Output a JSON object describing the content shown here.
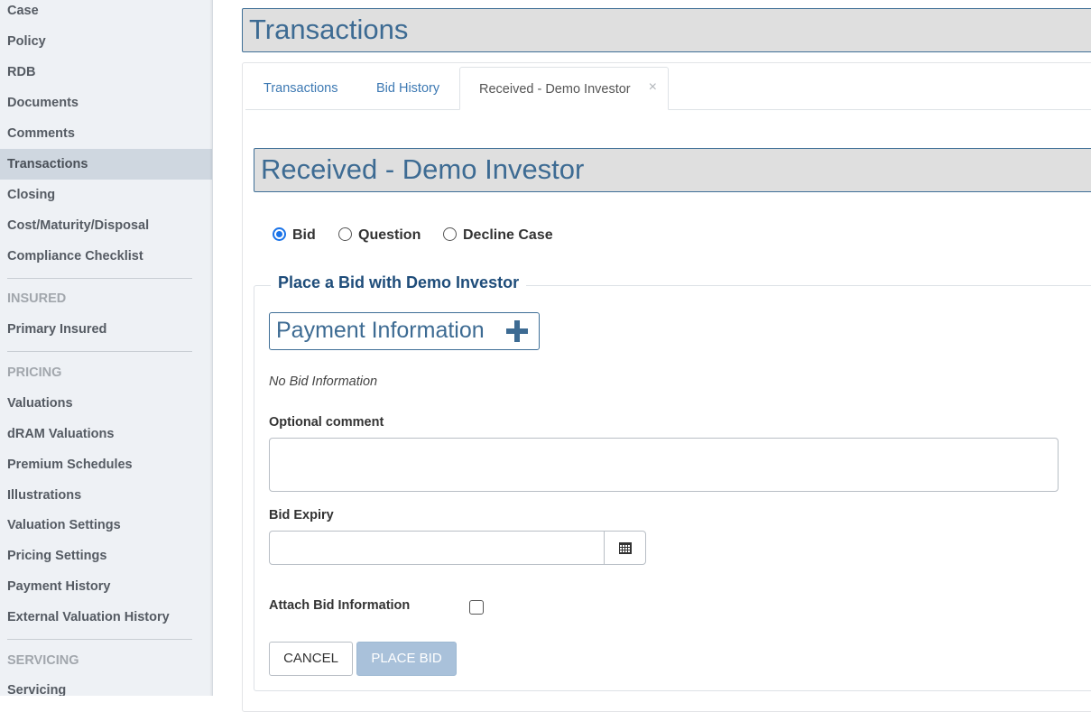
{
  "sidebar": {
    "items": [
      {
        "label": "Case"
      },
      {
        "label": "Policy"
      },
      {
        "label": "RDB"
      },
      {
        "label": "Documents"
      },
      {
        "label": "Comments"
      },
      {
        "label": "Transactions"
      },
      {
        "label": "Closing"
      },
      {
        "label": "Cost/Maturity/Disposal"
      },
      {
        "label": "Compliance Checklist"
      }
    ],
    "insured_header": "INSURED",
    "insured_items": [
      {
        "label": "Primary Insured"
      }
    ],
    "pricing_header": "PRICING",
    "pricing_items": [
      {
        "label": "Valuations"
      },
      {
        "label": "dRAM Valuations"
      },
      {
        "label": "Premium Schedules"
      },
      {
        "label": "Illustrations"
      },
      {
        "label": "Valuation Settings"
      },
      {
        "label": "Pricing Settings"
      },
      {
        "label": "Payment History"
      },
      {
        "label": "External Valuation History"
      }
    ],
    "servicing_header": "SERVICING",
    "servicing_items": [
      {
        "label": "Servicing"
      }
    ]
  },
  "header": {
    "title": "Transactions"
  },
  "tabs": [
    {
      "label": "Transactions"
    },
    {
      "label": "Bid History"
    },
    {
      "label": "Received - Demo Investor",
      "close": "×"
    }
  ],
  "section": {
    "title": "Received - Demo Investor"
  },
  "options": [
    {
      "label": "Bid",
      "checked": true
    },
    {
      "label": "Question",
      "checked": false
    },
    {
      "label": "Decline Case",
      "checked": false
    }
  ],
  "form": {
    "legend": "Place a Bid with Demo Investor",
    "payment_button": "Payment Information",
    "no_bid": "No Bid Information",
    "comment_label": "Optional comment",
    "comment_value": "",
    "expiry_label": "Bid Expiry",
    "expiry_value": "",
    "attach_label": "Attach Bid Information",
    "cancel_label": "CANCEL",
    "place_label": "PLACE BID"
  },
  "colors": {
    "accent": "#3d6b93",
    "link": "#3d79b3",
    "radio_selected": "#1a73e8",
    "place_bid_disabled": "#a9c1da",
    "sidebar_bg": "#eef1f5",
    "sidebar_active": "#cfd7e0"
  }
}
